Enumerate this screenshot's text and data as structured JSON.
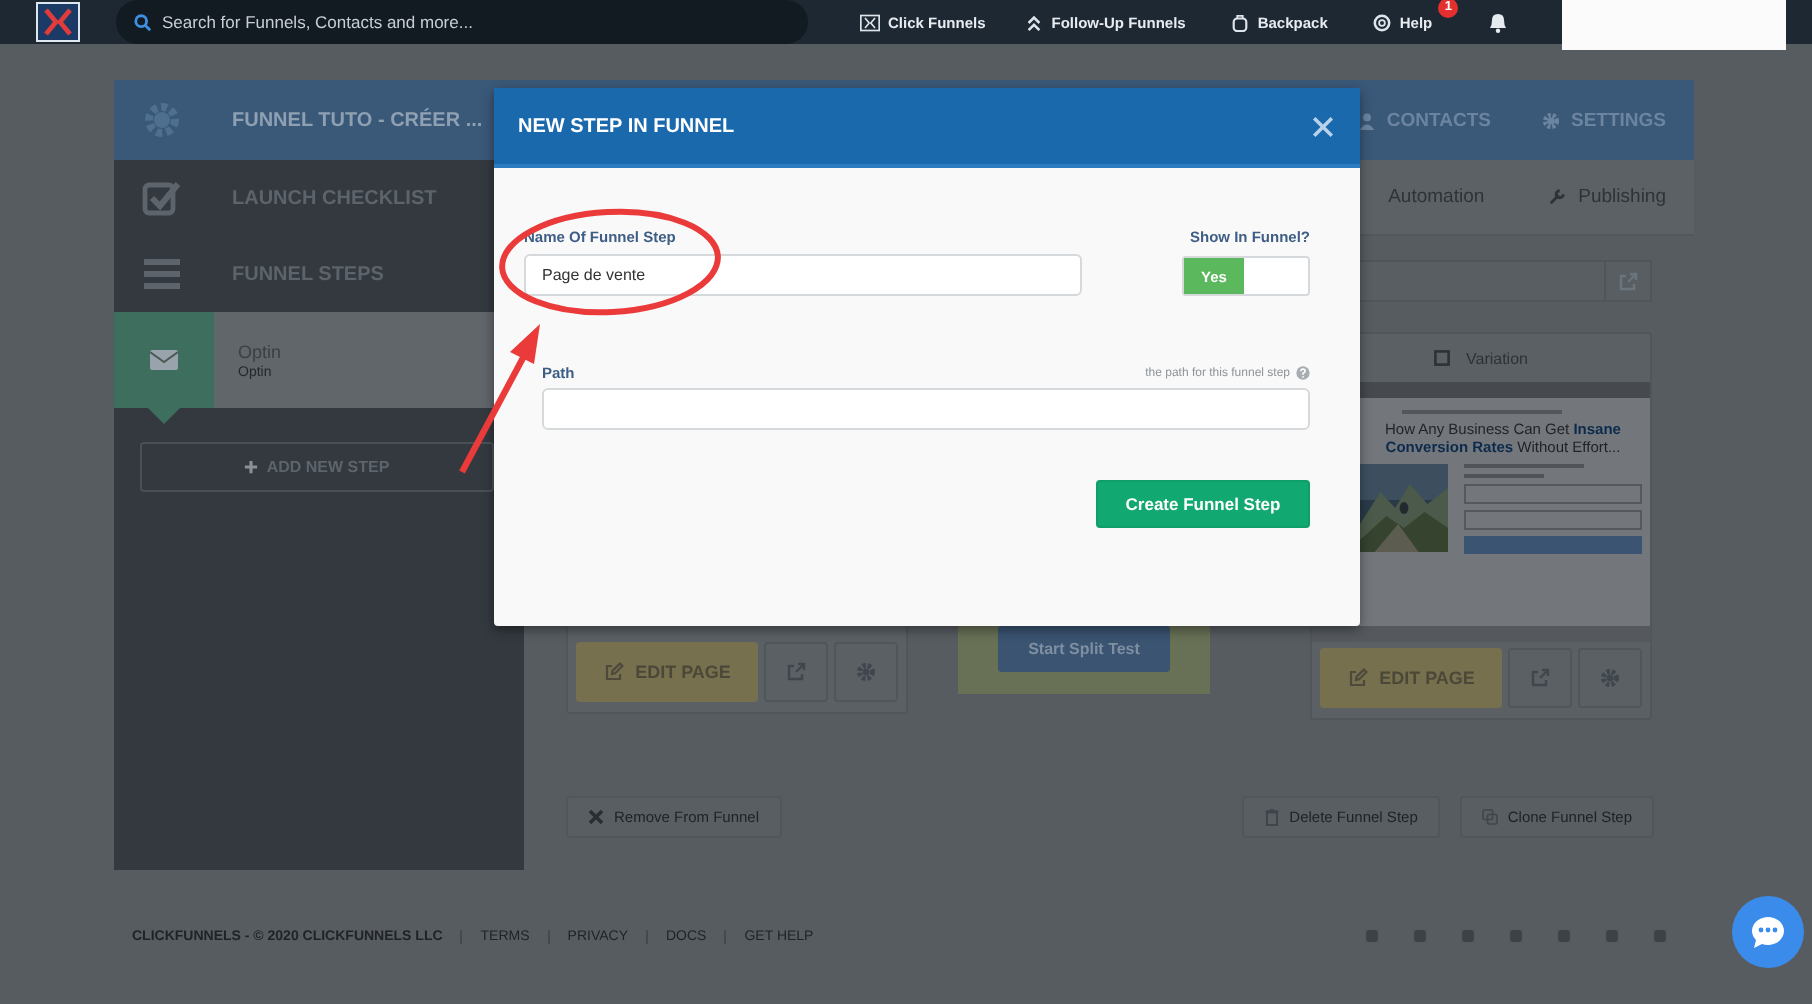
{
  "top_nav": {
    "search": {
      "placeholder": "Search for Funnels, Contacts and more..."
    },
    "links": [
      {
        "label": "Click Funnels",
        "kind": "funnels"
      },
      {
        "label": "Follow-Up Funnels",
        "kind": "followup"
      },
      {
        "label": "Backpack",
        "kind": "backpack"
      },
      {
        "label": "Help",
        "kind": "help",
        "badge": "1"
      }
    ]
  },
  "funnel": {
    "title": "FUNNEL TUTO - CRÉER ...",
    "sidebar_items": [
      {
        "label": "LAUNCH CHECKLIST",
        "kind": "checklist"
      },
      {
        "label": "FUNNEL STEPS",
        "kind": "steps"
      }
    ],
    "steps": [
      {
        "name": "Optin",
        "type": "Optin",
        "selected": true
      }
    ],
    "add_step_button": "ADD NEW STEP"
  },
  "header_tabs": [
    {
      "label": "CONTACTS",
      "kind": "contacts"
    },
    {
      "label": "SETTINGS",
      "kind": "settings"
    }
  ],
  "sub_tabs": [
    {
      "label": "Automation",
      "kind": "plain"
    },
    {
      "label": "Publishing",
      "kind": "publishing"
    }
  ],
  "variation": {
    "label": "Variation",
    "preview_headline": "How Any Business Can Get **Insane Conversion Rates** Without Effort..."
  },
  "edit_buttons": [
    "EDIT PAGE",
    "EDIT PAGE"
  ],
  "split_test_button": "Start Split Test",
  "step_actions": {
    "remove": "Remove From Funnel",
    "delete": "Delete Funnel Step",
    "clone": "Clone Funnel Step"
  },
  "footer": {
    "copyright": "CLICKFUNNELS - © 2020 CLICKFUNNELS LLC",
    "links": [
      "TERMS",
      "PRIVACY",
      "DOCS",
      "GET HELP"
    ]
  },
  "modal": {
    "title": "NEW STEP IN FUNNEL",
    "name_label": "Name Of Funnel Step",
    "name_value": "Page de vente",
    "show_in_funnel": {
      "label": "Show In Funnel?",
      "on": true,
      "on_text": "Yes"
    },
    "path_label": "Path",
    "path_hint": "the path for this funnel step",
    "submit": "Create Funnel Step"
  }
}
